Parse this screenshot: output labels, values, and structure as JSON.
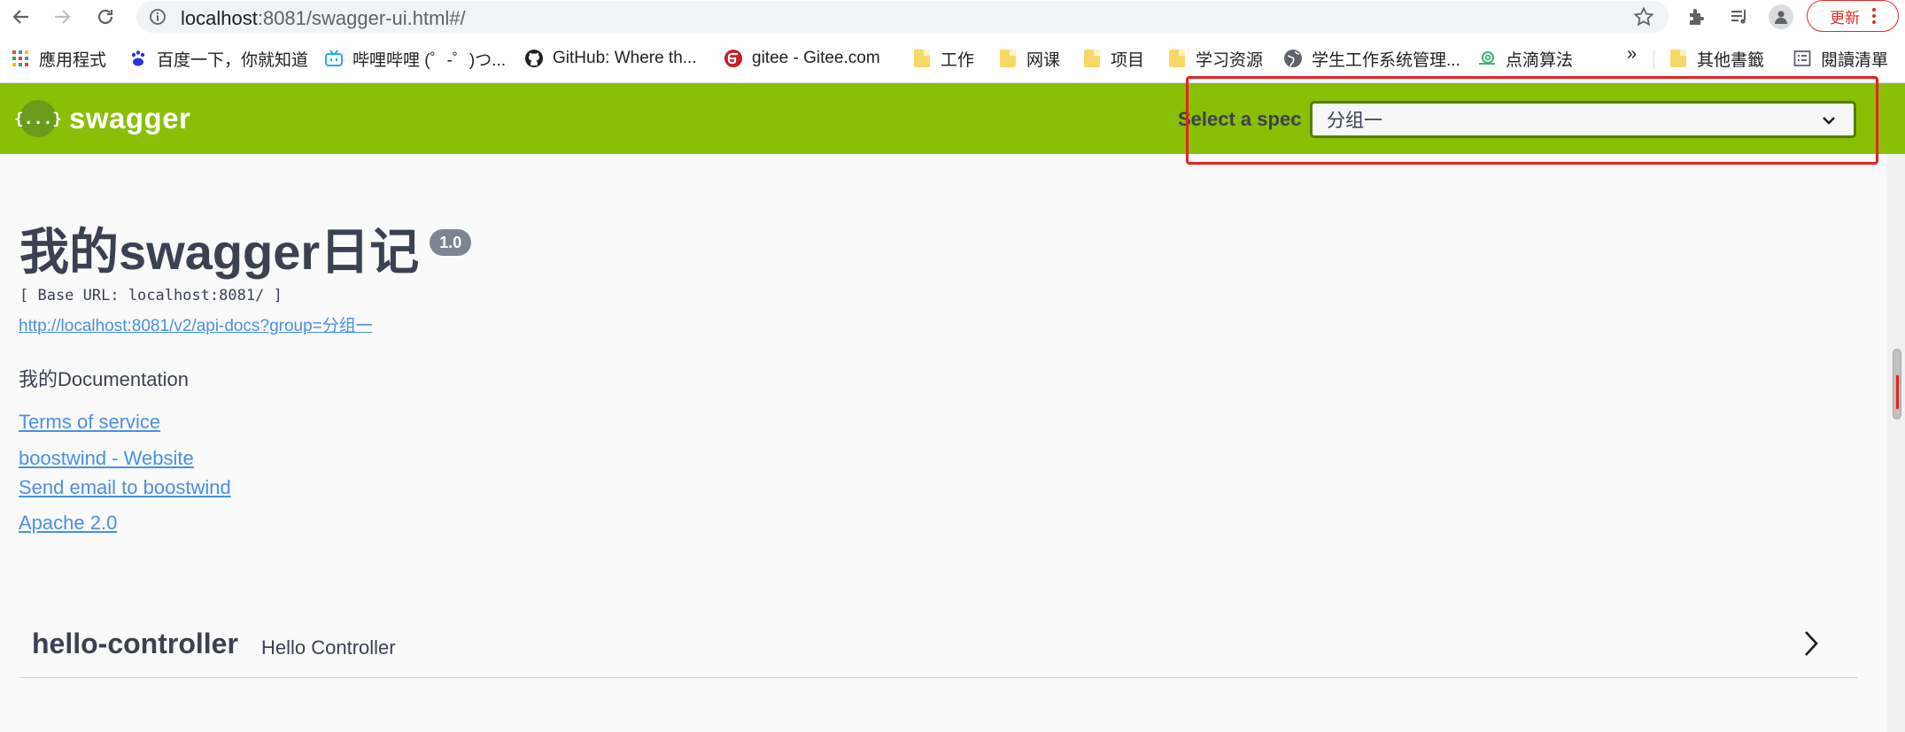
{
  "browser": {
    "url_host": "localhost",
    "url_path": ":8081/swagger-ui.html#/",
    "update_label": "更新"
  },
  "bookmarks": [
    {
      "label": "應用程式",
      "icon": "apps-grid-icon"
    },
    {
      "label": "百度一下，你就知道",
      "icon": "baidu-paw-icon"
    },
    {
      "label": "哔哩哔哩 (゜-゜)つ...",
      "icon": "bilibili-tv-icon"
    },
    {
      "label": "GitHub: Where th...",
      "icon": "github-icon"
    },
    {
      "label": "gitee - Gitee.com",
      "icon": "gitee-icon"
    },
    {
      "label": "工作",
      "icon": "folder-icon"
    },
    {
      "label": "网课",
      "icon": "folder-icon"
    },
    {
      "label": "项目",
      "icon": "folder-icon"
    },
    {
      "label": "学习资源",
      "icon": "folder-icon"
    },
    {
      "label": "学生工作系统管理...",
      "icon": "globe-icon"
    },
    {
      "label": "点滴算法",
      "icon": "snail-icon"
    }
  ],
  "bookmarks_more": "»",
  "bookmarks_right": [
    {
      "label": "其他書籤",
      "icon": "folder-icon"
    },
    {
      "label": "閱讀清單",
      "icon": "reading-list-icon"
    }
  ],
  "topbar": {
    "logo_text": "swagger",
    "logo_glyph": "{...}",
    "spec_label": "Select a spec",
    "spec_selected": "分组一"
  },
  "info": {
    "title": "我的swagger日记",
    "version": "1.0",
    "base_url": "[ Base URL: localhost:8081/ ]",
    "spec_url": "http://localhost:8081/v2/api-docs?group=分组一",
    "description": "我的Documentation",
    "terms": "Terms of service",
    "website": "boostwind - Website",
    "email": "Send email to boostwind",
    "license": "Apache 2.0"
  },
  "tags": [
    {
      "name": "hello-controller",
      "description": "Hello Controller"
    }
  ],
  "colors": {
    "topbar": "#89bf04",
    "link": "#4990e2",
    "highlight": "#e8211f"
  }
}
